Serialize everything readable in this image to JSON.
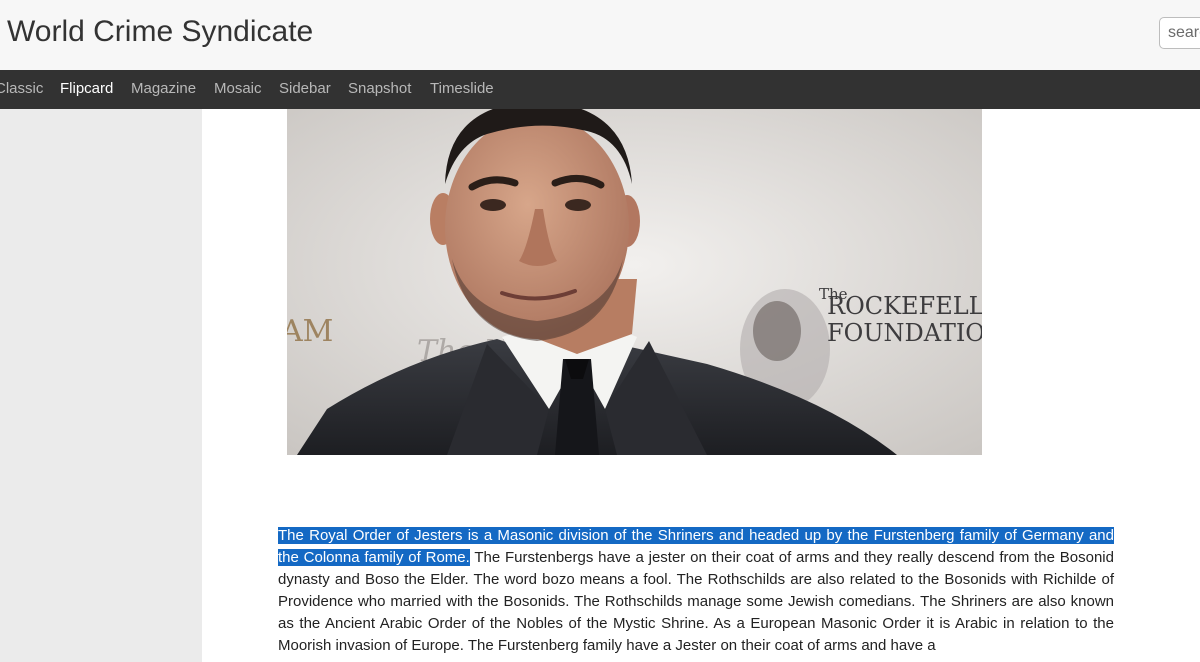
{
  "header": {
    "site_title": "World Crime Syndicate",
    "search_placeholder": "search"
  },
  "navbar": {
    "items": [
      {
        "label": "Classic",
        "active": false
      },
      {
        "label": "Flipcard",
        "active": true
      },
      {
        "label": "Magazine",
        "active": false
      },
      {
        "label": "Mosaic",
        "active": false
      },
      {
        "label": "Sidebar",
        "active": false
      },
      {
        "label": "Snapshot",
        "active": false
      },
      {
        "label": "Timeslide",
        "active": false
      }
    ]
  },
  "photo": {
    "backdrop_text": {
      "foundation_line1": "ROCKEFELL",
      "foundation_line2": "FOUNDATIO",
      "the_prefix": "The",
      "newspaper_fragment": "The N",
      "left_fragment": "AM"
    }
  },
  "article": {
    "selected_sentence": "The Royal Order of Jesters is a Masonic division of the Shriners and headed up by the Furstenberg family of Germany and the Colonna family of Rome.",
    "body": " The Furstenbergs have a jester on their coat of arms and they really descend from the Bosonid dynasty and Boso the Elder. The word bozo means a fool. The Rothschilds are also related to the Bosonids with Richilde of Providence who married with the Bosonids. The Rothschilds manage some Jewish comedians. The Shriners are also known as the Ancient Arabic Order of the Nobles of the Mystic Shrine. As a European Masonic Order it is Arabic in relation to the Moorish invasion of Europe. The Furstenberg family have a Jester on their coat of arms and have a"
  },
  "colors": {
    "navbar_bg": "#323232",
    "selection": "#1469c4",
    "page_bg": "#ebebeb"
  }
}
